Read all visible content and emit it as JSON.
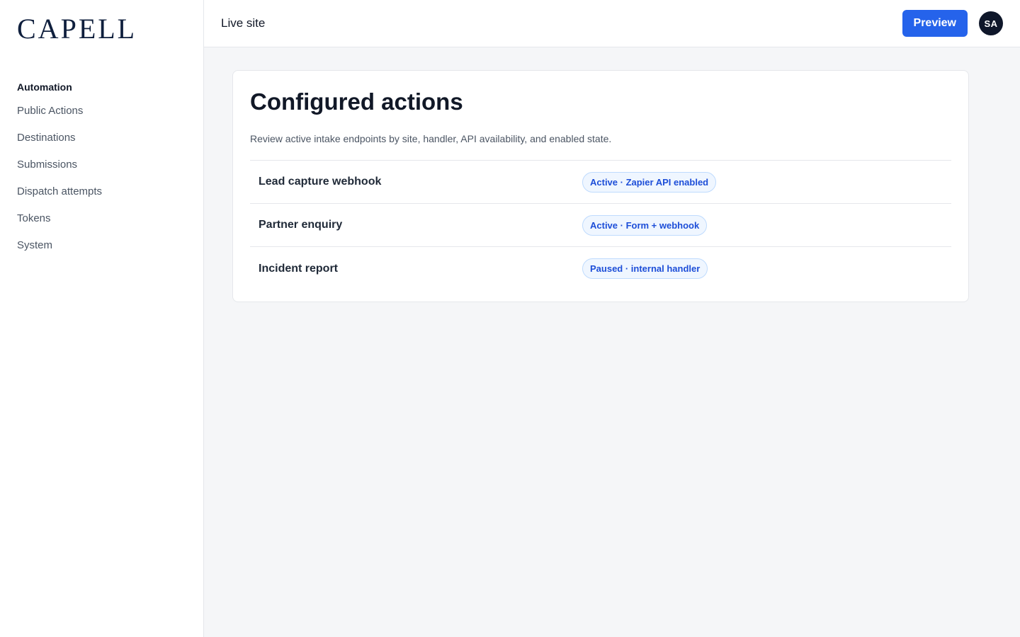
{
  "brand": {
    "logo_text": "CAPELL"
  },
  "sidebar": {
    "section_title": "Automation",
    "items": [
      {
        "label": "Public Actions"
      },
      {
        "label": "Destinations"
      },
      {
        "label": "Submissions"
      },
      {
        "label": "Dispatch attempts"
      },
      {
        "label": "Tokens"
      },
      {
        "label": "System"
      }
    ]
  },
  "topbar": {
    "title": "Live site",
    "preview_label": "Preview",
    "avatar_initials": "SA"
  },
  "main": {
    "title": "Configured actions",
    "description": "Review active intake endpoints by site, handler, API availability, and enabled state.",
    "actions": [
      {
        "name": "Lead capture webhook",
        "status": "Active · Zapier API enabled"
      },
      {
        "name": "Partner enquiry",
        "status": "Active · Form + webhook"
      },
      {
        "name": "Incident report",
        "status": "Paused · internal handler"
      }
    ]
  },
  "colors": {
    "accent": "#2563eb",
    "brand": "#0f1f3d",
    "badge_bg": "#eff6ff",
    "badge_text": "#1d4ed8"
  }
}
